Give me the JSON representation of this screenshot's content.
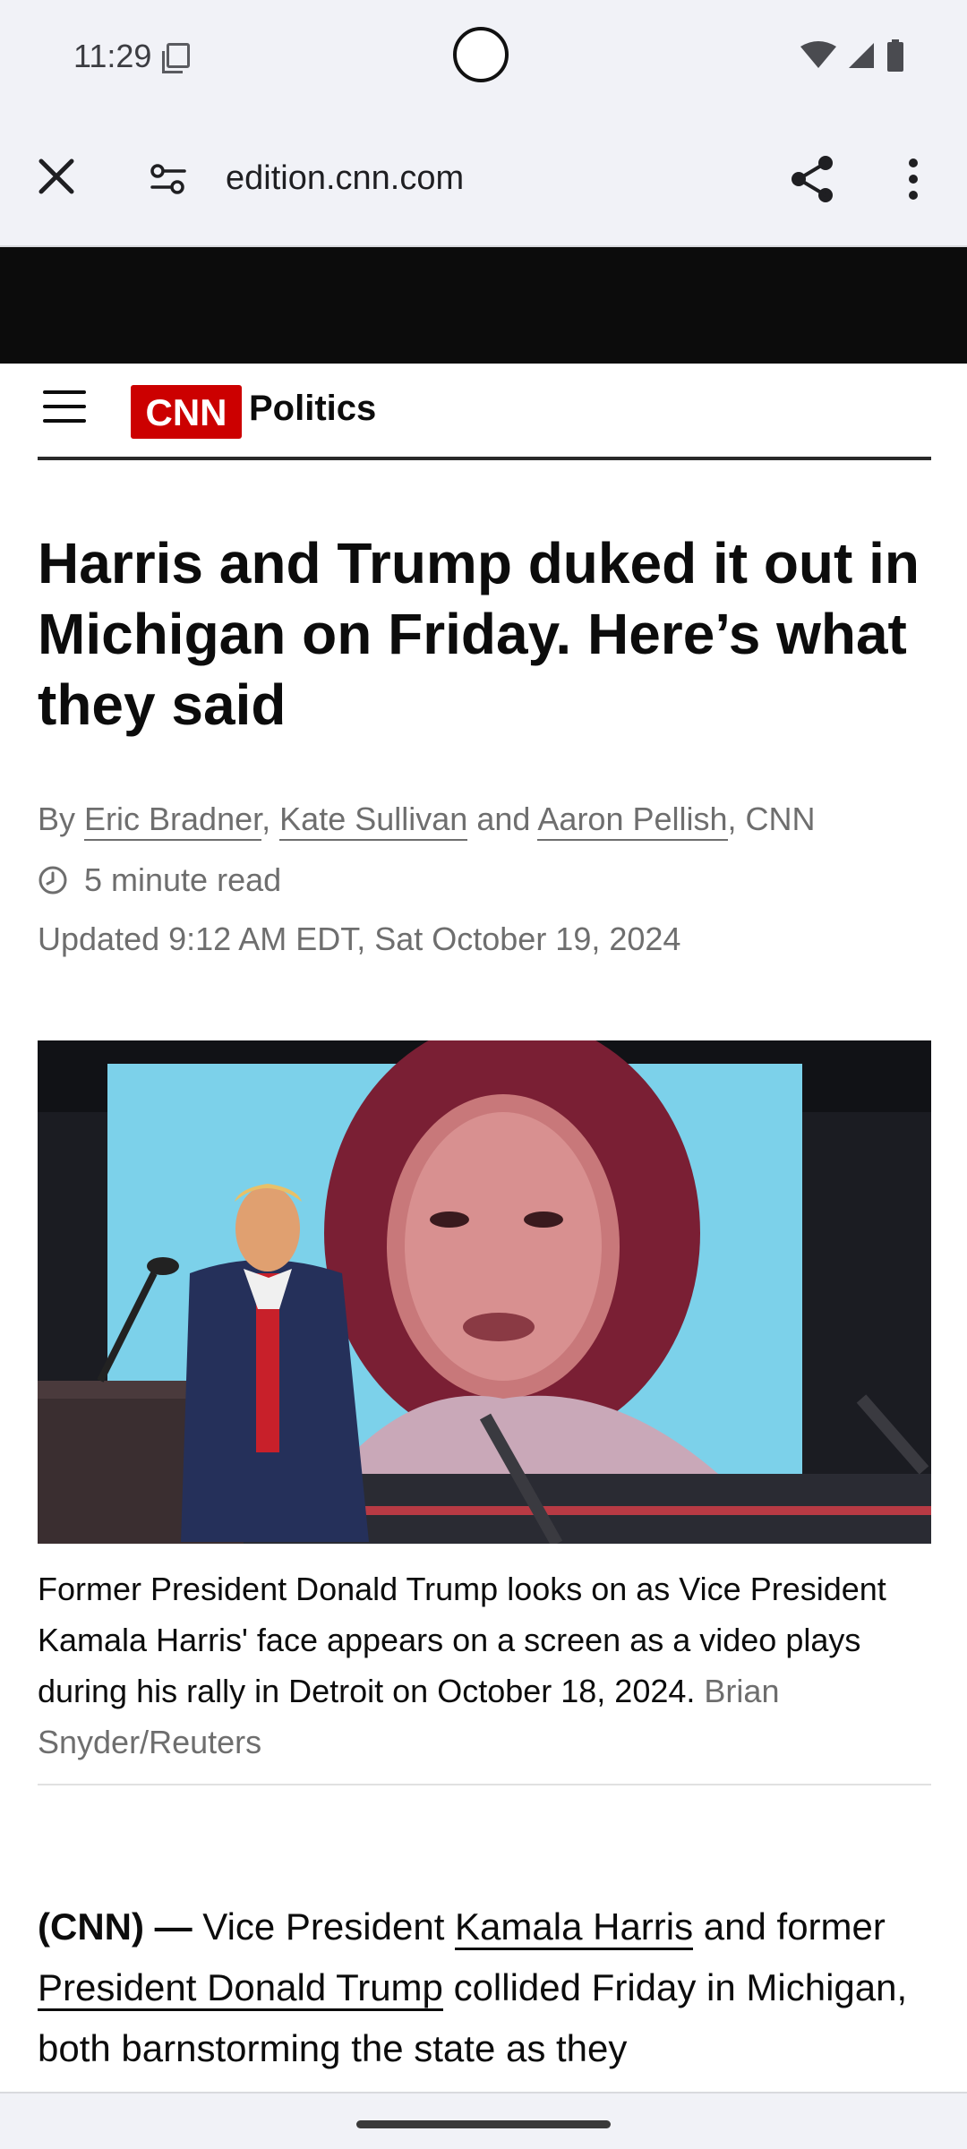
{
  "status_bar": {
    "time": "11:29"
  },
  "browser": {
    "url": "edition.cnn.com"
  },
  "site_header": {
    "logo_text": "CNN",
    "section": "Politics"
  },
  "article": {
    "headline": "Harris and Trump duked it out in Michigan on Friday. Here’s what they said",
    "byline": {
      "prefix": "By",
      "authors": [
        "Eric Bradner",
        "Kate Sullivan",
        "Aaron Pellish"
      ],
      "separator_comma": ",",
      "conjunction": "and",
      "suffix": ", CNN"
    },
    "read_time": "5 minute read",
    "updated": "Updated 9:12 AM EDT, Sat October 19, 2024",
    "image": {
      "caption": "Former President Donald Trump looks on as Vice President Kamala Harris' face appears on a screen as a video plays during his rally in Detroit on October 18, 2024.",
      "credit": "Brian Snyder/Reuters"
    },
    "body": {
      "lead": "(CNN) —",
      "t1": " Vice President ",
      "link1": "Kamala Harris",
      "t2": " and former ",
      "link2": "President Donald Trump",
      "t3": " collided Friday in Michigan, both barnstorming the state as they"
    }
  },
  "colors": {
    "cnn_red": "#cc0000",
    "text": "#0c0c0c",
    "meta_text": "#6e6e6e",
    "chrome_bg": "#f1f2f7"
  },
  "icons": {
    "close": "close-icon",
    "site_settings": "tune-icon",
    "share": "share-icon",
    "menu": "more-vert-icon",
    "hamburger": "hamburger-icon",
    "clock": "clock-icon"
  }
}
